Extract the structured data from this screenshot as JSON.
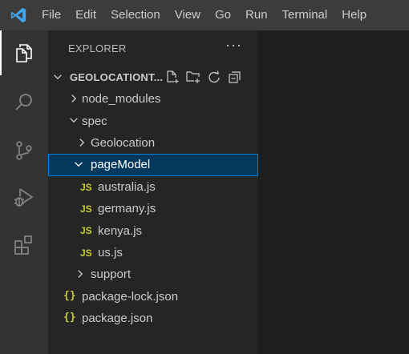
{
  "menu": [
    "File",
    "Edit",
    "Selection",
    "View",
    "Go",
    "Run",
    "Terminal",
    "Help"
  ],
  "activity_bar": [
    "explorer-icon",
    "search-icon",
    "source-control-icon",
    "run-debug-icon",
    "extensions-icon"
  ],
  "explorer": {
    "title": "EXPLORER",
    "more": "···",
    "project": "GEOLOCATIONT...",
    "actions": [
      "new-file-icon",
      "new-folder-icon",
      "refresh-icon",
      "collapse-all-icon"
    ]
  },
  "tree": [
    {
      "label": "node_modules",
      "type": "folder",
      "expanded": false
    },
    {
      "label": "spec",
      "type": "folder",
      "expanded": true
    },
    {
      "label": "Geolocation",
      "type": "folder",
      "expanded": false
    },
    {
      "label": "pageModel",
      "type": "folder",
      "expanded": true,
      "selected": true
    },
    {
      "label": "australia.js",
      "type": "js"
    },
    {
      "label": "germany.js",
      "type": "js"
    },
    {
      "label": "kenya.js",
      "type": "js"
    },
    {
      "label": "us.js",
      "type": "js"
    },
    {
      "label": "support",
      "type": "folder",
      "expanded": false
    },
    {
      "label": "package-lock.json",
      "type": "json"
    },
    {
      "label": "package.json",
      "type": "json"
    }
  ],
  "file_icons": {
    "js": "JS",
    "json": "{}"
  },
  "colors": {
    "titlebar": "#3c3c3c",
    "activitybar": "#333333",
    "sidebar": "#252526",
    "editor": "#1e1e1e",
    "selection": "#04395e",
    "focus_border": "#007fd4",
    "js_icon": "#cbcb41",
    "vscode_blue": "#3ea6f2"
  }
}
